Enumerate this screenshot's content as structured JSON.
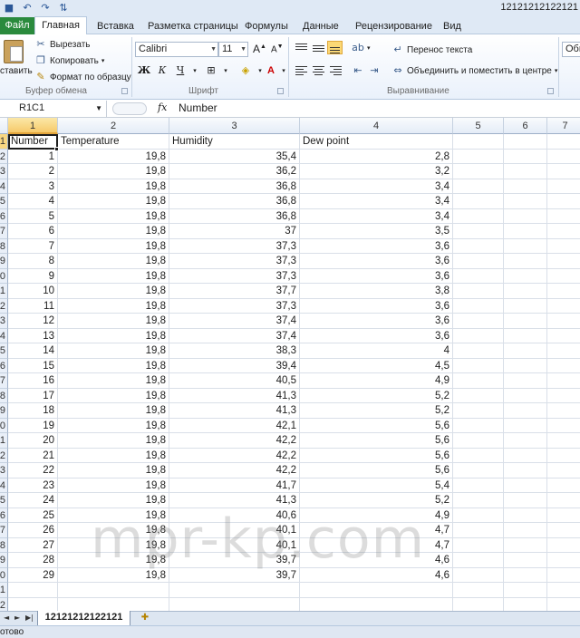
{
  "window": {
    "title": "12121212122121"
  },
  "qat": [
    {
      "icon": "save-icon",
      "glyph": "■"
    },
    {
      "icon": "undo-icon",
      "glyph": "↶"
    },
    {
      "icon": "redo-icon",
      "glyph": "↷"
    },
    {
      "icon": "sort-icon",
      "glyph": "⇅"
    }
  ],
  "tabs": {
    "file": "Файл",
    "home": "Главная",
    "insert": "Вставка",
    "layout": "Разметка страницы",
    "formulas": "Формулы",
    "data": "Данные",
    "review": "Рецензирование",
    "view": "Вид"
  },
  "clipboard": {
    "paste": "ставить",
    "cut": "Вырезать",
    "copy": "Копировать",
    "format_painter": "Формат по образцу",
    "group": "Буфер обмена"
  },
  "font": {
    "name": "Calibri",
    "size": "11",
    "bold": "Ж",
    "italic": "К",
    "underline": "Ч",
    "group": "Шрифт"
  },
  "alignment": {
    "wrap": "Перенос текста",
    "merge": "Объединить и поместить в центре",
    "group": "Выравнивание"
  },
  "number": {
    "format": "Общ"
  },
  "formula_bar": {
    "name_box": "R1C1",
    "fx": "fx",
    "value": "Number"
  },
  "columns": [
    "1",
    "2",
    "3",
    "4",
    "5",
    "6",
    "7"
  ],
  "headers": [
    "Number",
    "Temperature",
    "Humidity",
    "Dew point"
  ],
  "rows": [
    [
      "1",
      "19,8",
      "35,4",
      "2,8"
    ],
    [
      "2",
      "19,8",
      "36,2",
      "3,2"
    ],
    [
      "3",
      "19,8",
      "36,8",
      "3,4"
    ],
    [
      "4",
      "19,8",
      "36,8",
      "3,4"
    ],
    [
      "5",
      "19,8",
      "36,8",
      "3,4"
    ],
    [
      "6",
      "19,8",
      "37",
      "3,5"
    ],
    [
      "7",
      "19,8",
      "37,3",
      "3,6"
    ],
    [
      "8",
      "19,8",
      "37,3",
      "3,6"
    ],
    [
      "9",
      "19,8",
      "37,3",
      "3,6"
    ],
    [
      "10",
      "19,8",
      "37,7",
      "3,8"
    ],
    [
      "11",
      "19,8",
      "37,3",
      "3,6"
    ],
    [
      "12",
      "19,8",
      "37,4",
      "3,6"
    ],
    [
      "13",
      "19,8",
      "37,4",
      "3,6"
    ],
    [
      "14",
      "19,8",
      "38,3",
      "4"
    ],
    [
      "15",
      "19,8",
      "39,4",
      "4,5"
    ],
    [
      "16",
      "19,8",
      "40,5",
      "4,9"
    ],
    [
      "17",
      "19,8",
      "41,3",
      "5,2"
    ],
    [
      "18",
      "19,8",
      "41,3",
      "5,2"
    ],
    [
      "19",
      "19,8",
      "42,1",
      "5,6"
    ],
    [
      "20",
      "19,8",
      "42,2",
      "5,6"
    ],
    [
      "21",
      "19,8",
      "42,2",
      "5,6"
    ],
    [
      "22",
      "19,8",
      "42,2",
      "5,6"
    ],
    [
      "23",
      "19,8",
      "41,7",
      "5,4"
    ],
    [
      "24",
      "19,8",
      "41,3",
      "5,2"
    ],
    [
      "25",
      "19,8",
      "40,6",
      "4,9"
    ],
    [
      "26",
      "19,8",
      "40,1",
      "4,7"
    ],
    [
      "27",
      "19,8",
      "40,1",
      "4,7"
    ],
    [
      "28",
      "19,8",
      "39,7",
      "4,6"
    ],
    [
      "29",
      "19,8",
      "39,7",
      "4,6"
    ]
  ],
  "row_numbers": [
    "1",
    "2",
    "3",
    "4",
    "5",
    "6",
    "7",
    "8",
    "9",
    "0",
    "1",
    "2",
    "3",
    "4",
    "5",
    "6",
    "7",
    "8",
    "9",
    "0",
    "1",
    "2",
    "3",
    "4",
    "5",
    "6",
    "7",
    "8",
    "9",
    "0",
    "1",
    "2"
  ],
  "sheet": {
    "tab": "12121212122121",
    "nav": [
      "◄",
      "►"
    ]
  },
  "status": {
    "text": "отово"
  },
  "watermark": "mpr-kp.com"
}
